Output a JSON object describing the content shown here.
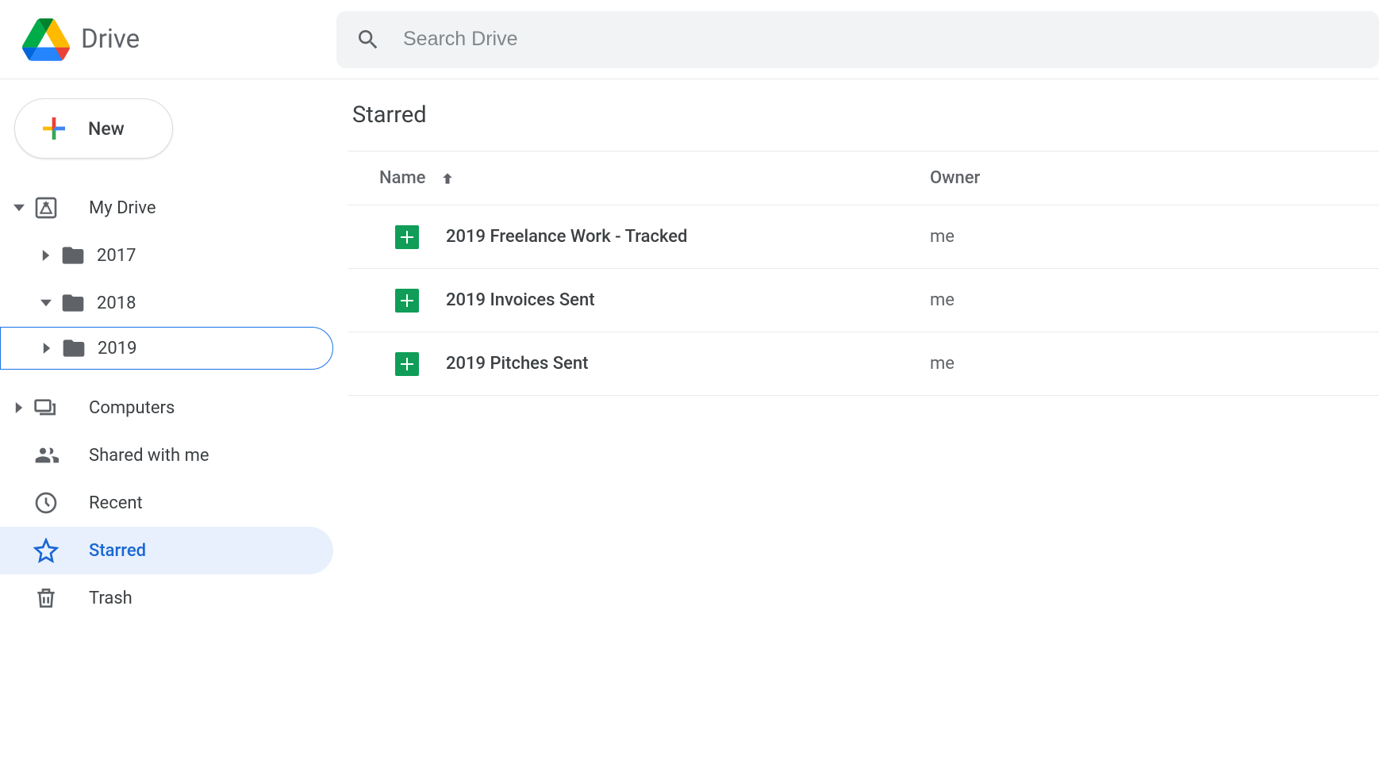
{
  "header": {
    "app_name": "Drive",
    "search_placeholder": "Search Drive"
  },
  "sidebar": {
    "new_label": "New",
    "my_drive": "My Drive",
    "folders": [
      {
        "name": "2017",
        "expanded": false
      },
      {
        "name": "2018",
        "expanded": true
      },
      {
        "name": "2019",
        "expanded": false,
        "selected": true
      }
    ],
    "computers": "Computers",
    "shared": "Shared with me",
    "recent": "Recent",
    "starred": "Starred",
    "trash": "Trash"
  },
  "main": {
    "title": "Starred",
    "columns": {
      "name": "Name",
      "owner": "Owner"
    },
    "files": [
      {
        "name": "2019 Freelance Work - Tracked",
        "owner": "me",
        "type": "sheets"
      },
      {
        "name": "2019 Invoices Sent",
        "owner": "me",
        "type": "sheets"
      },
      {
        "name": "2019 Pitches Sent",
        "owner": "me",
        "type": "sheets"
      }
    ]
  }
}
